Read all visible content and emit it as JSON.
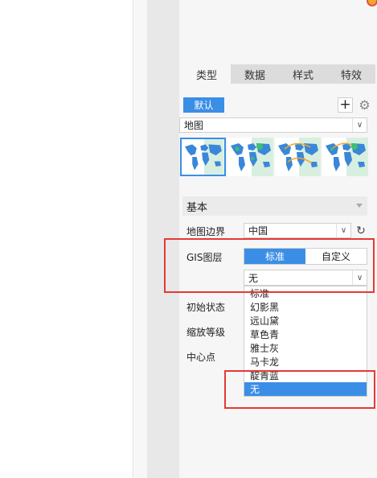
{
  "tabs": [
    {
      "label": "类型",
      "active": true
    },
    {
      "label": "数据",
      "active": false
    },
    {
      "label": "样式",
      "active": false
    },
    {
      "label": "特效",
      "active": false
    }
  ],
  "chart_type": {
    "default_label": "默认",
    "add_icon": "plus-icon",
    "settings_icon": "gear-icon",
    "selected_value": "地图",
    "thumbnails": [
      {
        "icon": "world-map-icon",
        "selected": true
      },
      {
        "icon": "world-map-pin-icon",
        "selected": false
      },
      {
        "icon": "world-map-flow-icon",
        "selected": false
      },
      {
        "icon": "world-map-pin-flow-icon",
        "selected": false
      }
    ]
  },
  "basic_section": {
    "title": "基本",
    "map_boundary": {
      "label": "地图边界",
      "value": "中国"
    },
    "gis_layer": {
      "label": "GIS图层",
      "modes": [
        "标准",
        "自定义"
      ],
      "active_mode": "标准",
      "selected_value": "无",
      "options": [
        "标准",
        "幻影黑",
        "远山黛",
        "草色青",
        "雅士灰",
        "马卡龙",
        "靛青蓝",
        "无"
      ],
      "highlighted_option": "无"
    },
    "initial_state_label": "初始状态",
    "zoom_level_label": "缩放等级",
    "center_label": "中心点"
  },
  "colors": {
    "accent": "#3b8ee6",
    "annotation_red": "#e53935",
    "panel_bg": "#f6f6f6"
  }
}
